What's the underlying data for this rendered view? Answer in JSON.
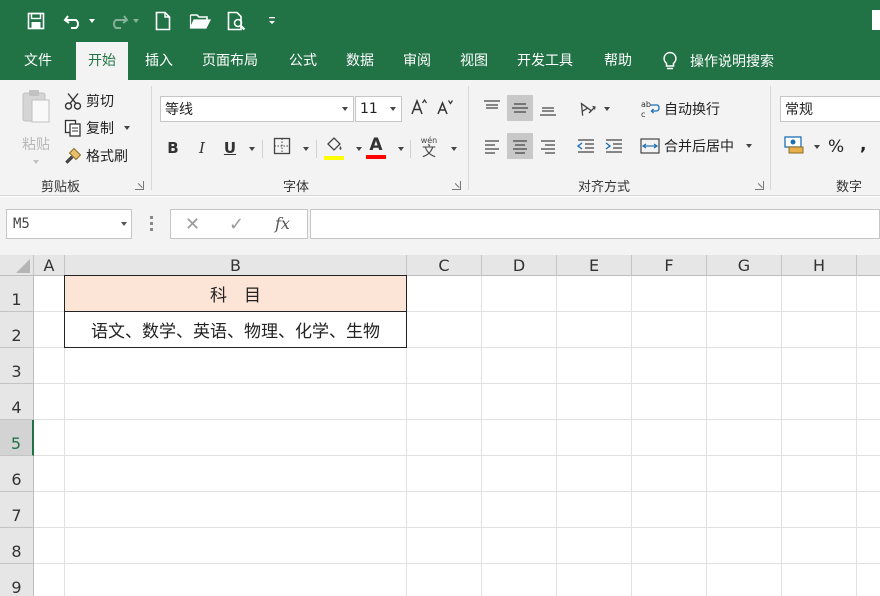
{
  "qat": {
    "icons": [
      "save-icon",
      "undo-icon",
      "redo-icon",
      "new-file-icon",
      "open-folder-icon",
      "print-preview-icon",
      "customize-qat-icon"
    ]
  },
  "tabs": [
    {
      "label": "文件",
      "active": false
    },
    {
      "label": "开始",
      "active": true
    },
    {
      "label": "插入",
      "active": false
    },
    {
      "label": "页面布局",
      "active": false
    },
    {
      "label": "公式",
      "active": false
    },
    {
      "label": "数据",
      "active": false
    },
    {
      "label": "审阅",
      "active": false
    },
    {
      "label": "视图",
      "active": false
    },
    {
      "label": "开发工具",
      "active": false
    },
    {
      "label": "帮助",
      "active": false
    }
  ],
  "tell_me": {
    "label": "操作说明搜索"
  },
  "clipboard": {
    "paste": "粘贴",
    "cut": "剪切",
    "copy": "复制",
    "format_painter": "格式刷",
    "group_label": "剪贴板"
  },
  "font": {
    "font_name": "等线",
    "font_size": "11",
    "bold": "B",
    "italic": "I",
    "underline": "U",
    "phonetic": "wén",
    "phonetic_char": "文",
    "font_color": "#ff0000",
    "fill_color": "#ffff00",
    "group_label": "字体"
  },
  "alignment": {
    "wrap_text": "自动换行",
    "merge_center": "合并后居中",
    "group_label": "对齐方式"
  },
  "number": {
    "format": "常规",
    "percent": "%",
    "group_label": "数字"
  },
  "formula_bar": {
    "name_box": "M5",
    "cancel": "✕",
    "enter": "✓",
    "fx": "fx",
    "content": ""
  },
  "grid": {
    "columns": [
      "A",
      "B",
      "C",
      "D",
      "E",
      "F",
      "G",
      "H"
    ],
    "rows": [
      "1",
      "2",
      "3",
      "4",
      "5",
      "6",
      "7",
      "8",
      "9"
    ],
    "selected_row": "5",
    "cells": {
      "B1": "科　目",
      "B2": "语文、数学、英语、物理、化学、生物"
    },
    "header_fill": "#fce4d6",
    "accent": "#217346"
  }
}
